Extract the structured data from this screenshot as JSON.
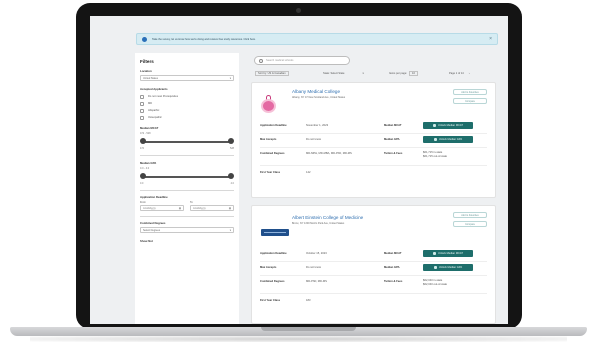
{
  "banner": {
    "text": "Take the survey, let us know how we're doing and receive free study resources. Click here.",
    "close": "×"
  },
  "filters": {
    "title": "Filters",
    "location_label": "Location",
    "location_value": "United States",
    "degree_label": "Accepted Applicants",
    "degree_options": [
      "Do not meet Prerequisites",
      "MD",
      "Allopathic",
      "Osteopathic"
    ],
    "mcat_label": "Median MCAT",
    "mcat_sub": "472 - 528",
    "mcat_min": "472",
    "mcat_max": "528",
    "mcat_low_fraction": 0,
    "mcat_high_fraction": 1,
    "gpa_label": "Median GPA",
    "gpa_sub": "0.0 - 4.0",
    "gpa_min": "0.0",
    "gpa_max": "4.0",
    "gpa_low_fraction": 0,
    "gpa_high_fraction": 1,
    "deadline_label": "Application Deadline",
    "from_label": "From",
    "to_label": "To",
    "date_placeholder": "mm/dd/yyyy",
    "combined_label": "Combined Degrees",
    "combined_value": "Select Degrees",
    "show_more": "Show Not"
  },
  "search": {
    "placeholder": "Search medical schools"
  },
  "toolbar": {
    "sort_label": "Sort by: US & Canadian",
    "filter_label": "State: Select State",
    "per_page_label": "Items per page:",
    "per_page_value": "10",
    "pager": "Page 1 of 14"
  },
  "schools": [
    {
      "name": "Albany Medical College",
      "address": "Albany, NY 47 New Scotland Ave, United States",
      "save_label": "Add to Favorites",
      "compare_label": "Compare",
      "deadline_key": "Application Deadline",
      "deadline_val": "November 1, 2023",
      "type_key": "Max Accepts",
      "type_val": "Do not know",
      "combined_key": "Combined Degrees",
      "combined_val": "MD-MPH, MD-MBA, MD-PhD, MD-MS",
      "first_key": "First Year Class",
      "first_val": "142",
      "mcat_key": "Median MCAT",
      "mcat_btn": "Unlock Median MCAT",
      "gpa_key": "Median GPA",
      "gpa_btn": "Unlock Median GPA",
      "tuition_key": "Tuition & Fees",
      "tuition_val1": "$61,715 in-state",
      "tuition_val2": "$61,715 out-of-state"
    },
    {
      "name": "Albert Einstein College of Medicine",
      "address": "Bronx, NY 1300 Morris Park Ave, United States",
      "save_label": "Add to Favorites",
      "compare_label": "Compare",
      "deadline_key": "Application Deadline",
      "deadline_val": "October 15, 2023",
      "type_key": "Max Accepts",
      "type_val": "Do not know",
      "combined_key": "Combined Degrees",
      "combined_val": "MD-PhD, MD-MS",
      "first_key": "First Year Class",
      "first_val": "183",
      "mcat_key": "Median MCAT",
      "mcat_btn": "Unlock Median MCAT",
      "gpa_key": "Median GPA",
      "gpa_btn": "Unlock Median GPA",
      "tuition_key": "Tuition & Fees",
      "tuition_val1": "$62,040 in-state",
      "tuition_val2": "$62,040 out-of-state"
    }
  ]
}
